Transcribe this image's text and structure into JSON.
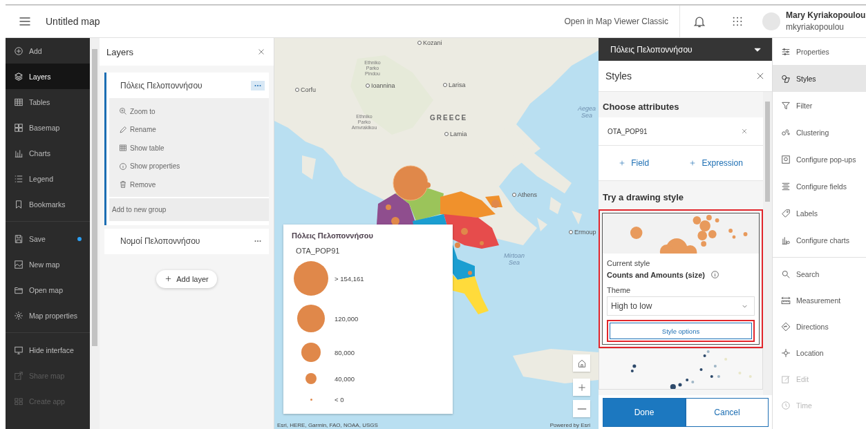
{
  "header": {
    "title": "Untitled map",
    "link": "Open in Map Viewer Classic",
    "user": {
      "name": "Mary Kyriakopoulou",
      "username": "mkyriakopoulou"
    }
  },
  "nav": {
    "groups": [
      [
        {
          "label": "Add",
          "selected": false,
          "disabled": false,
          "unsaved": false
        },
        {
          "label": "Layers",
          "selected": true,
          "disabled": false,
          "unsaved": false
        },
        {
          "label": "Tables",
          "selected": false,
          "disabled": false,
          "unsaved": false
        },
        {
          "label": "Basemap",
          "selected": false,
          "disabled": false,
          "unsaved": false
        },
        {
          "label": "Charts",
          "selected": false,
          "disabled": false,
          "unsaved": false
        },
        {
          "label": "Legend",
          "selected": false,
          "disabled": false,
          "unsaved": false
        },
        {
          "label": "Bookmarks",
          "selected": false,
          "disabled": false,
          "unsaved": false
        }
      ],
      [
        {
          "label": "Save",
          "selected": false,
          "disabled": false,
          "unsaved": true
        },
        {
          "label": "New map",
          "selected": false,
          "disabled": false,
          "unsaved": false
        },
        {
          "label": "Open map",
          "selected": false,
          "disabled": false,
          "unsaved": false
        },
        {
          "label": "Map properties",
          "selected": false,
          "disabled": false,
          "unsaved": false
        }
      ],
      [
        {
          "label": "Hide interface",
          "selected": false,
          "disabled": false,
          "unsaved": false
        },
        {
          "label": "Share map",
          "selected": false,
          "disabled": true,
          "unsaved": false
        },
        {
          "label": "Create app",
          "selected": false,
          "disabled": true,
          "unsaved": false
        }
      ]
    ]
  },
  "layers_panel": {
    "title": "Layers",
    "layers": [
      {
        "name": "Πόλεις Πελοποννήσου",
        "selected": true,
        "expanded": true,
        "actions": [
          "Zoom to",
          "Rename",
          "Show table",
          "Show properties",
          "Remove"
        ],
        "group_action": "Add to new group"
      },
      {
        "name": "Νομοί Πελοποννήσου",
        "selected": false,
        "expanded": false
      }
    ],
    "add_button": "Add layer"
  },
  "map": {
    "labels": [
      {
        "text": "Kozani",
        "kind": "city"
      },
      {
        "text": "Ethniko Parko Pindou",
        "kind": "park"
      },
      {
        "text": "Ioannina",
        "kind": "city"
      },
      {
        "text": "Larisa",
        "kind": "city"
      },
      {
        "text": "Corfu",
        "kind": "city"
      },
      {
        "text": "Ethniko Parko Amvrakikou",
        "kind": "park"
      },
      {
        "text": "GREECE",
        "kind": "country"
      },
      {
        "text": "Lamia",
        "kind": "city"
      },
      {
        "text": "Aegea Sea",
        "kind": "sea"
      },
      {
        "text": "Athens",
        "kind": "city"
      },
      {
        "text": "Ermoup",
        "kind": "city"
      },
      {
        "text": "Mirtoan Sea",
        "kind": "sea"
      }
    ],
    "legend": {
      "layer": "Πόλεις Πελοποννήσου",
      "field": "OTA_POP91",
      "classes": [
        "> 154,161",
        "120,000",
        "80,000",
        "40,000",
        "< 0"
      ]
    },
    "attribution": "Esri, HERE, Garmin, FAO, NOAA, USGS",
    "powered_by": "Powered by Esri"
  },
  "styles_panel": {
    "layer": "Πόλεις Πελοποννήσου",
    "title": "Styles",
    "attributes_heading": "Choose attributes",
    "fields": [
      "OTA_POP91"
    ],
    "add_links": [
      "Field",
      "Expression"
    ],
    "drawing_heading": "Try a drawing style",
    "styles": [
      {
        "kind": "size",
        "selected": true,
        "highlighted": true,
        "caption": "Current style",
        "name": "Counts and Amounts (size)",
        "theme_label": "Theme",
        "theme": "High to low",
        "options_button": "Style options",
        "button_highlighted": true
      },
      {
        "kind": "color",
        "selected": false,
        "highlighted": false
      }
    ],
    "done": "Done",
    "cancel": "Cancel"
  },
  "tools": {
    "groups": [
      [
        {
          "label": "Properties",
          "selected": false,
          "disabled": false
        },
        {
          "label": "Styles",
          "selected": true,
          "disabled": false
        },
        {
          "label": "Filter",
          "selected": false,
          "disabled": false
        },
        {
          "label": "Clustering",
          "selected": false,
          "disabled": false
        },
        {
          "label": "Configure pop-ups",
          "selected": false,
          "disabled": false
        },
        {
          "label": "Configure fields",
          "selected": false,
          "disabled": false
        },
        {
          "label": "Labels",
          "selected": false,
          "disabled": false
        },
        {
          "label": "Configure charts",
          "selected": false,
          "disabled": false
        }
      ],
      [
        {
          "label": "Search",
          "selected": false,
          "disabled": false
        },
        {
          "label": "Measurement",
          "selected": false,
          "disabled": false
        },
        {
          "label": "Directions",
          "selected": false,
          "disabled": false
        },
        {
          "label": "Location",
          "selected": false,
          "disabled": false
        },
        {
          "label": "Edit",
          "selected": false,
          "disabled": true
        },
        {
          "label": "Time",
          "selected": false,
          "disabled": true
        }
      ]
    ]
  }
}
